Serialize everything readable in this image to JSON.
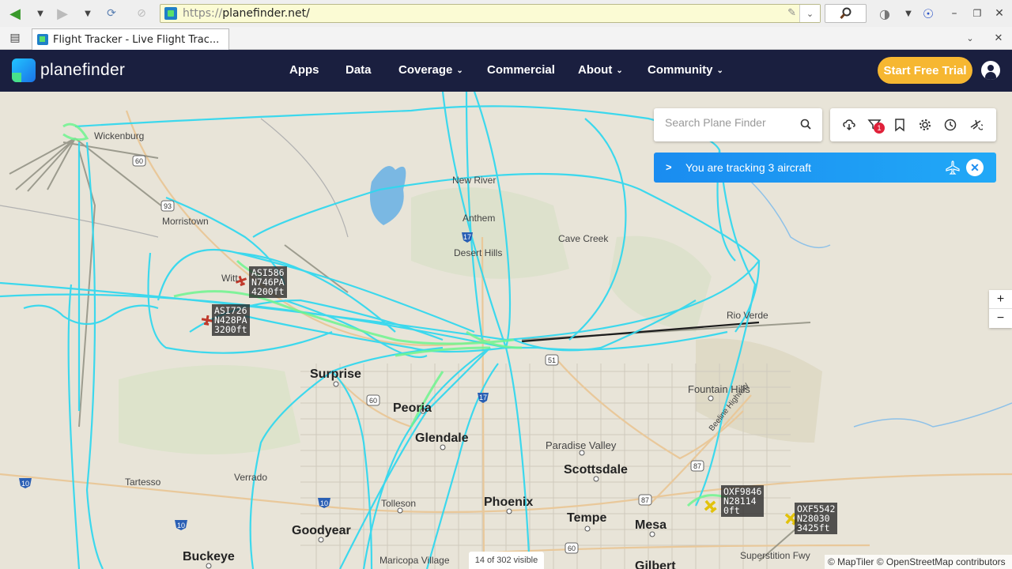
{
  "browser": {
    "url_prefix": "https://",
    "url_host": "planefinder.net/",
    "tab_title": "Flight Tracker - Live Flight Trac..."
  },
  "header": {
    "logo_text": "planefinder",
    "nav": [
      {
        "label": "Apps",
        "dropdown": false
      },
      {
        "label": "Data",
        "dropdown": false
      },
      {
        "label": "Coverage",
        "dropdown": true
      },
      {
        "label": "Commercial",
        "dropdown": false
      },
      {
        "label": "About",
        "dropdown": true
      },
      {
        "label": "Community",
        "dropdown": true
      }
    ],
    "trial_button": "Start Free Trial"
  },
  "map": {
    "search_placeholder": "Search Plane Finder",
    "filter_badge": "1",
    "tracking_text": "You are tracking 3 aircraft",
    "zoom_in": "+",
    "zoom_out": "−",
    "visible_count": "14 of 302 visible",
    "attribution": "© MapTiler © OpenStreetMap contributors",
    "aircraft": [
      {
        "callsign": "ASI586",
        "reg": "N746PA",
        "alt": "4200ft"
      },
      {
        "callsign": "ASI726",
        "reg": "N428PA",
        "alt": "3200ft"
      },
      {
        "callsign": "OXF9846",
        "reg": "N28114",
        "alt": "0ft"
      },
      {
        "callsign": "OXF5542",
        "reg": "N28030",
        "alt": "3425ft"
      }
    ],
    "places": {
      "wickenburg": "Wickenburg",
      "morristown": "Morristown",
      "wittmann": "Witt",
      "new_river": "New River",
      "anthem": "Anthem",
      "cave_creek": "Cave Creek",
      "desert_hills": "Desert Hills",
      "rio_verde": "Rio Verde",
      "surprise": "Surprise",
      "fountain_hills": "Fountain Hills",
      "peoria": "Peoria",
      "glendale": "Glendale",
      "paradise_valley": "Paradise Valley",
      "scottsdale": "Scottsdale",
      "tartesso": "Tartesso",
      "verrado": "Verrado",
      "tolleson": "Tolleson",
      "phoenix": "Phoenix",
      "tempe": "Tempe",
      "mesa": "Mesa",
      "goodyear": "Goodyear",
      "buckeye": "Buckeye",
      "maricopa_village": "Maricopa Village",
      "gilbert": "Gilbert",
      "superstition_fwy": "Superstition Fwy",
      "beeline_hwy": "Beeline Highway"
    },
    "highways": [
      "60",
      "10",
      "17",
      "51",
      "87",
      "93"
    ]
  },
  "colors": {
    "header_bg": "#1a1f3f",
    "trial_bg": "#f6b731",
    "track_cyan": "#2ed8ef",
    "track_green": "#6ff58f",
    "tracking_bar": "#1a8cf0"
  }
}
